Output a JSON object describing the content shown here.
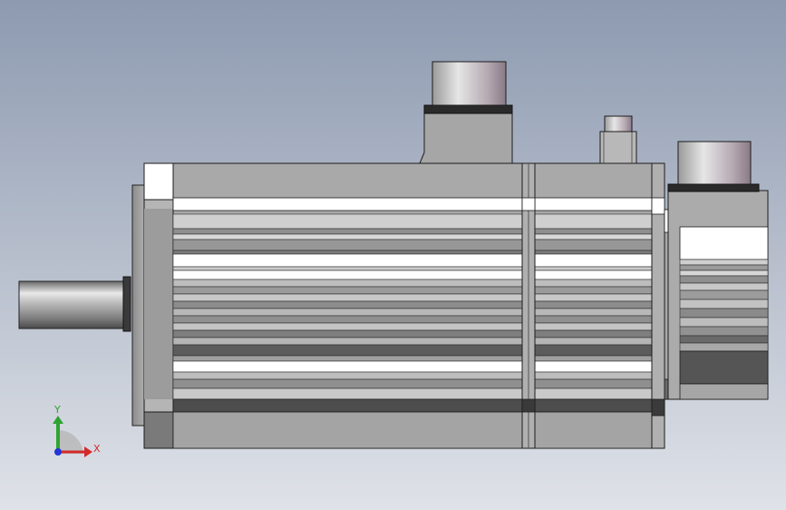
{
  "viewport": {
    "background_top": "#8d9ab0",
    "background_bottom": "#dfe2e8"
  },
  "triad": {
    "x_label": "X",
    "y_label": "Y",
    "x_color": "#d42a2a",
    "y_color": "#2fa332",
    "z_color": "#2335d6"
  },
  "colors": {
    "body": "#a7a7a7",
    "body_light": "#c2c2c2",
    "body_dark": "#5f5f5f",
    "edge": "#1c1c1c",
    "highlight": "#ffffff"
  }
}
